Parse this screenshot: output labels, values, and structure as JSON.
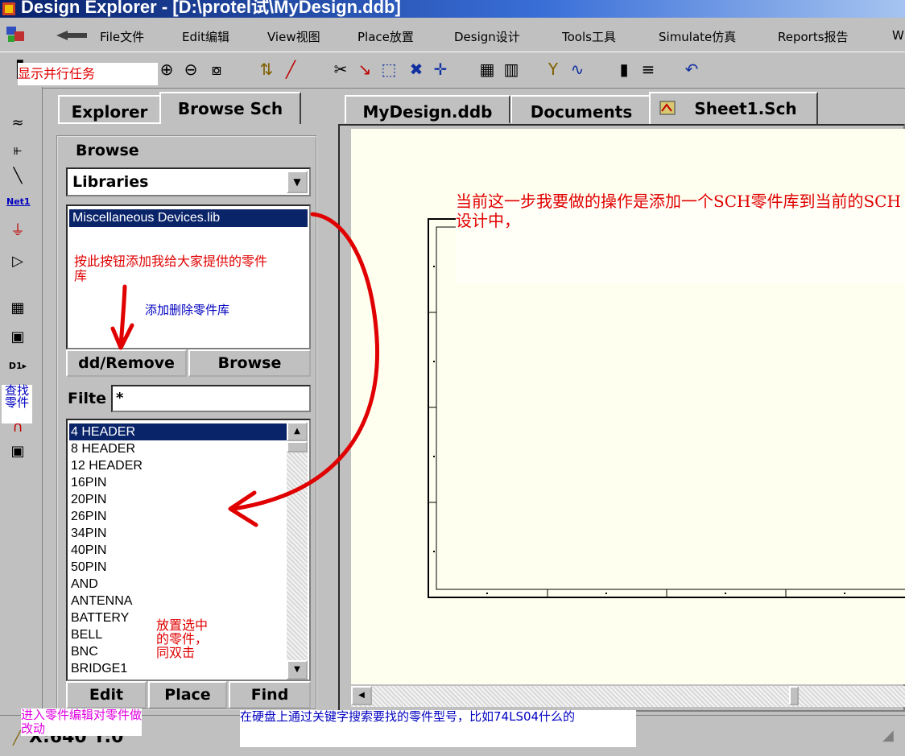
{
  "window": {
    "title": "Design Explorer - [D:\\protel试\\MyDesign.ddb]"
  },
  "menu": {
    "items": [
      {
        "label": "File文件"
      },
      {
        "label": "Edit编辑"
      },
      {
        "label": "View视图"
      },
      {
        "label": "Place放置"
      },
      {
        "label": "Design设计"
      },
      {
        "label": "Tools工具"
      },
      {
        "label": "Simulate仿真"
      },
      {
        "label": "Reports报告"
      },
      {
        "label": "W"
      }
    ]
  },
  "panel": {
    "tabs": [
      "Explorer",
      "Browse Sch"
    ],
    "group_title": "Browse",
    "library_select": "Libraries",
    "libraries": [
      "Miscellaneous Devices.lib"
    ],
    "add_remove_label": "dd/Remove",
    "browse_label": "Browse",
    "filter_label": "Filte",
    "filter_value": "*",
    "parts": [
      "4 HEADER",
      "8 HEADER",
      "12 HEADER",
      "16PIN",
      "20PIN",
      "26PIN",
      "34PIN",
      "40PIN",
      "50PIN",
      "AND",
      "ANTENNA",
      "BATTERY",
      "BELL",
      "BNC",
      "BRIDGE1"
    ],
    "edit_label": "Edit",
    "place_label": "Place",
    "find_label": "Find"
  },
  "documents": {
    "tabs": [
      "MyDesign.ddb",
      "Documents",
      "Sheet1.Sch"
    ]
  },
  "palette": {
    "net_label": "Net1"
  },
  "status": {
    "coords": "X:640 Y:0"
  },
  "annotations": {
    "show_tasks": "显示并行任务",
    "add_button_note": "按此按钮添加我给大家提供的零件库",
    "add_remove_note": "添加删除零件库",
    "find_parts": "查找零件",
    "step_note": "当前这一步我要做的操作是添加一个SCH零件库到当前的SCH设计中，",
    "place_note": "放置选中的零件，同双击",
    "edit_note": "进入零件编辑对零件做改动",
    "search_note": "在硬盘上通过关键字搜索要找的零件型号，比如74LS04什么的"
  },
  "colors": {
    "annotation_red": "#e00000",
    "annotation_blue": "#0000c0",
    "annotation_magenta": "#e000e0",
    "selection": "#0a246a",
    "canvas": "#fffff0"
  }
}
